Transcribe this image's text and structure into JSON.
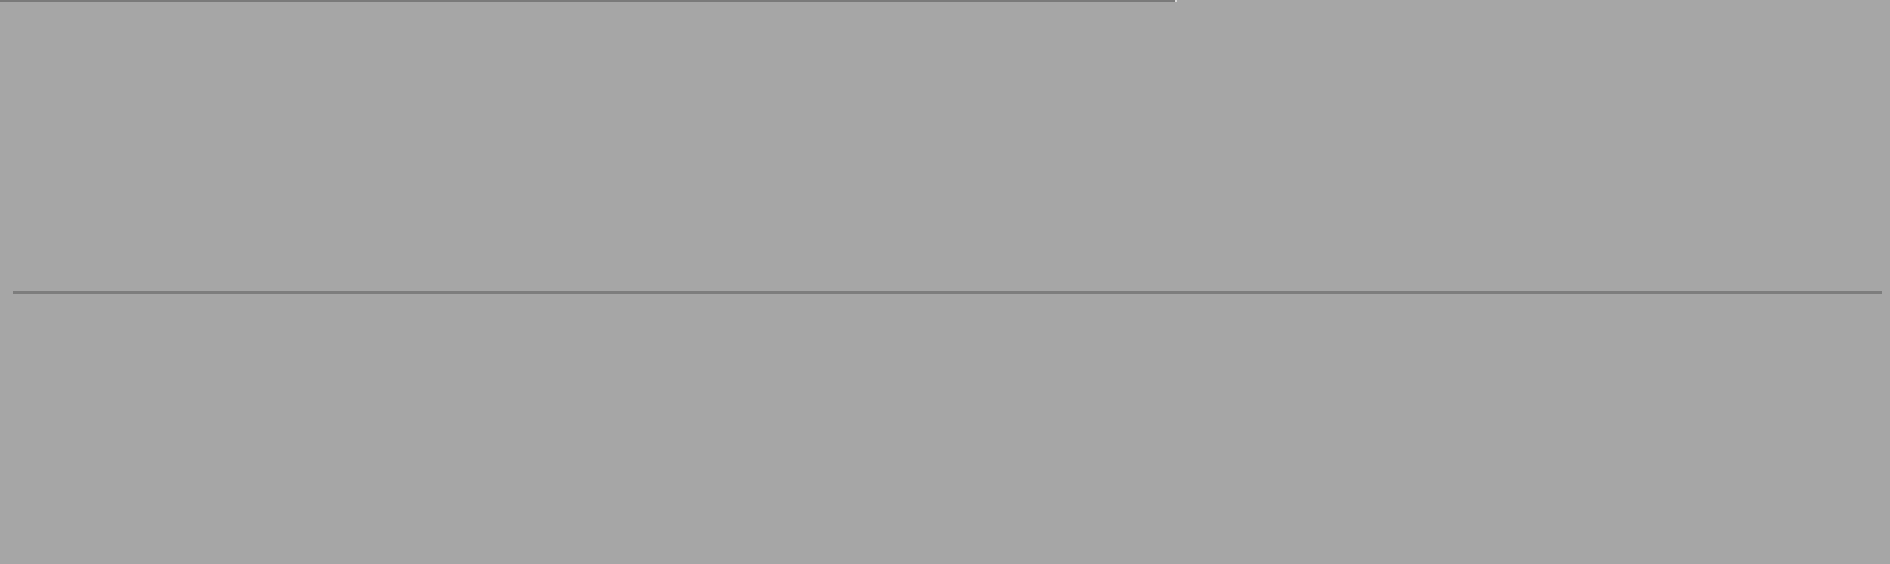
{
  "colors": {
    "background": "#a6a6a6",
    "top_bar": "#7a7a7a",
    "top_bar_cap": "#d9d9d9",
    "divider": "#7d7d7d"
  }
}
